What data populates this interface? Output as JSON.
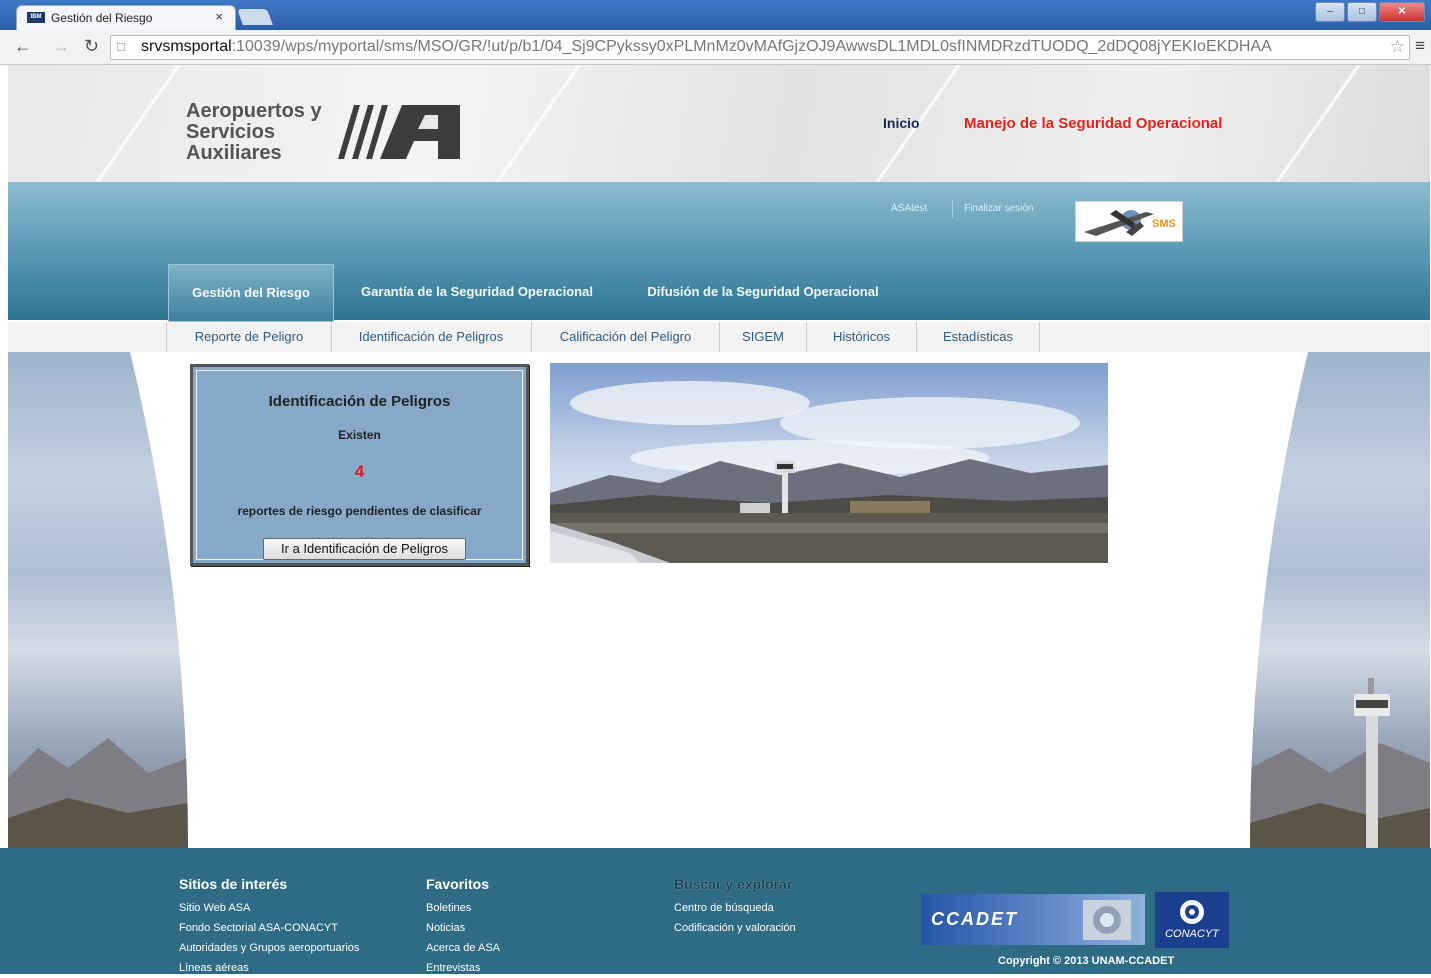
{
  "browser": {
    "tab_title": "Gestión del Riesgo",
    "tab_close": "×",
    "url_host": "srvsmsportal",
    "url_rest": ":10039/wps/myportal/sms/MSO/GR/!ut/p/b1/04_Sj9CPykssy0xPLMnMz0vMAfGjzOJ9AwwsDL1MDL0sfINMDRzdTUODQ_2dDQ08jYEKIoEKDHAA"
  },
  "header": {
    "logo_line1": "Aeropuertos y",
    "logo_line2": "Servicios",
    "logo_line3": "Auxiliares",
    "inicio": "Inicio",
    "site_title": "Manejo de la Seguridad Operacional"
  },
  "band": {
    "user": "ASAtest",
    "logout": "Finalizar sesión",
    "sms_logo": "SMS"
  },
  "primary_tabs": [
    "Gestión del Riesgo",
    "Garantía de la Seguridad Operacional",
    "Difusión de la Seguridad Operacional"
  ],
  "sub_tabs": [
    "Reporte de Peligro",
    "Identificación de Peligros",
    "Calificación del Peligro",
    "SIGEM",
    "Históricos",
    "Estadísticas"
  ],
  "card": {
    "title": "Identificación de Peligros",
    "existen": "Existen",
    "count": "4",
    "description": "reportes de riesgo pendientes de clasificar",
    "button": "Ir a Identificación de Peligros"
  },
  "footer": {
    "col1": {
      "title": "Sitios de interés",
      "links": [
        "Sitio Web ASA",
        "Fondo Sectorial ASA-CONACYT",
        "Autoridades y Grupos aeroportuarios",
        "Líneas aéreas"
      ]
    },
    "col2": {
      "title": "Favoritos",
      "links": [
        "Boletines",
        "Noticias",
        "Acerca de ASA",
        "Entrevistas"
      ]
    },
    "col3": {
      "title": "Buscar y explorar",
      "links": [
        "Centro de búsqueda",
        "Codificación y valoración"
      ]
    },
    "ccadet": "CCADET",
    "conacyt": "CONACYT",
    "copyright": "Copyright © 2013 UNAM-CCADET"
  },
  "colors": {
    "accent_red": "#e3231c",
    "band_teal": "#2f7593",
    "footer": "#2e6c85",
    "card_bg": "#86a8c9"
  }
}
